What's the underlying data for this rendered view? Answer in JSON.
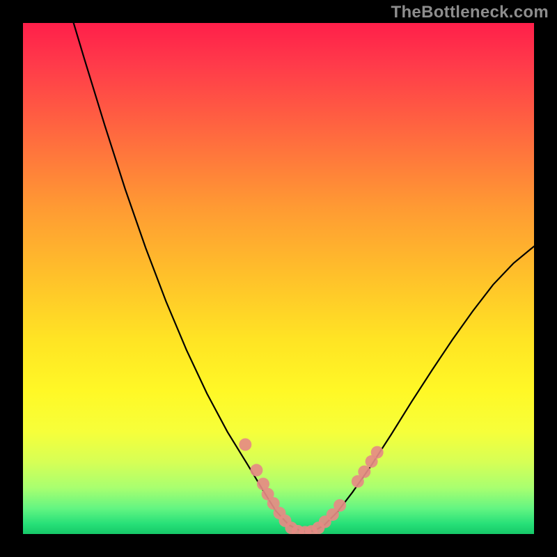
{
  "watermark": "TheBottleneck.com",
  "colors": {
    "frame": "#000000",
    "marker": "#e58b84",
    "curve": "#000000"
  },
  "chart_data": {
    "type": "line",
    "title": "",
    "xlabel": "",
    "ylabel": "",
    "xlim": [
      0,
      100
    ],
    "ylim": [
      0,
      100
    ],
    "grid": false,
    "legend": false,
    "note": "V-shaped bottleneck curve; axes unlabeled; values read off pixel scale (x,y where y=100 at top, 0 at bottom).",
    "series": [
      {
        "name": "curve",
        "type": "line",
        "points": [
          {
            "x": 9.9,
            "y": 100.0
          },
          {
            "x": 12.0,
            "y": 93.0
          },
          {
            "x": 16.0,
            "y": 80.0
          },
          {
            "x": 20.0,
            "y": 67.5
          },
          {
            "x": 24.0,
            "y": 56.0
          },
          {
            "x": 28.0,
            "y": 45.5
          },
          {
            "x": 32.0,
            "y": 36.0
          },
          {
            "x": 36.0,
            "y": 27.5
          },
          {
            "x": 40.0,
            "y": 20.0
          },
          {
            "x": 44.0,
            "y": 13.5
          },
          {
            "x": 47.0,
            "y": 8.5
          },
          {
            "x": 49.5,
            "y": 4.5
          },
          {
            "x": 52.0,
            "y": 1.8
          },
          {
            "x": 54.5,
            "y": 0.5
          },
          {
            "x": 57.0,
            "y": 0.6
          },
          {
            "x": 59.0,
            "y": 1.8
          },
          {
            "x": 61.5,
            "y": 4.3
          },
          {
            "x": 64.5,
            "y": 8.2
          },
          {
            "x": 68.0,
            "y": 13.2
          },
          {
            "x": 72.0,
            "y": 19.4
          },
          {
            "x": 76.0,
            "y": 25.8
          },
          {
            "x": 80.0,
            "y": 32.0
          },
          {
            "x": 84.0,
            "y": 38.0
          },
          {
            "x": 88.0,
            "y": 43.6
          },
          {
            "x": 92.0,
            "y": 48.8
          },
          {
            "x": 96.0,
            "y": 53.0
          },
          {
            "x": 100.0,
            "y": 56.3
          }
        ]
      },
      {
        "name": "markers",
        "type": "scatter",
        "points": [
          {
            "x": 43.5,
            "y": 17.5
          },
          {
            "x": 45.7,
            "y": 12.5
          },
          {
            "x": 47.0,
            "y": 9.8
          },
          {
            "x": 47.9,
            "y": 7.8
          },
          {
            "x": 49.0,
            "y": 6.0
          },
          {
            "x": 50.2,
            "y": 4.1
          },
          {
            "x": 51.3,
            "y": 2.6
          },
          {
            "x": 52.5,
            "y": 1.2
          },
          {
            "x": 53.8,
            "y": 0.55
          },
          {
            "x": 55.2,
            "y": 0.35
          },
          {
            "x": 56.4,
            "y": 0.5
          },
          {
            "x": 57.8,
            "y": 1.2
          },
          {
            "x": 59.1,
            "y": 2.4
          },
          {
            "x": 60.6,
            "y": 3.8
          },
          {
            "x": 62.0,
            "y": 5.6
          },
          {
            "x": 65.5,
            "y": 10.3
          },
          {
            "x": 66.8,
            "y": 12.2
          },
          {
            "x": 68.2,
            "y": 14.2
          },
          {
            "x": 69.3,
            "y": 16.0
          }
        ]
      }
    ]
  }
}
